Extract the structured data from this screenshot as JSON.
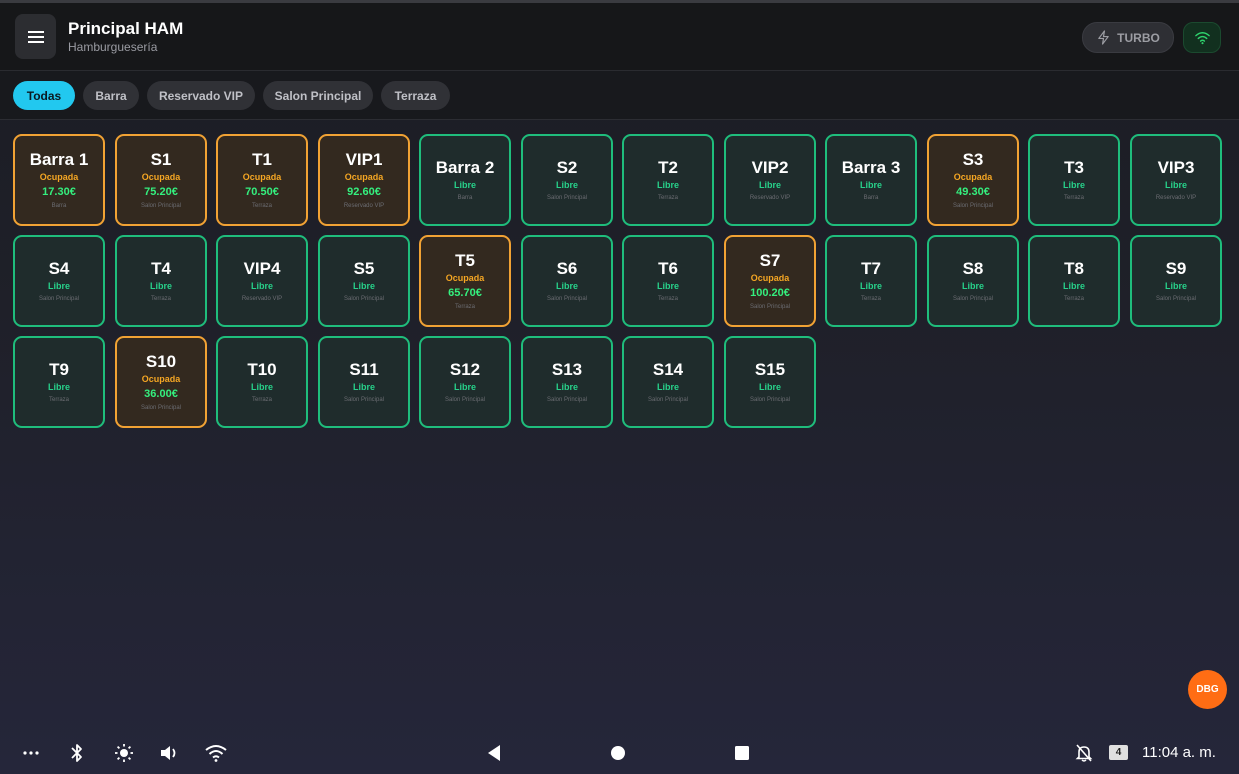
{
  "header": {
    "title": "Principal HAM",
    "subtitle": "Hamburguesería",
    "menu_icon": "hamburger-menu-icon",
    "turbo_label": "TURBO",
    "turbo_icon": "lightning-bolt-icon",
    "wifi_icon": "wifi-icon"
  },
  "tabs": [
    {
      "label": "Todas",
      "active": true
    },
    {
      "label": "Barra",
      "active": false
    },
    {
      "label": "Reservado VIP",
      "active": false
    },
    {
      "label": "Salon Principal",
      "active": false
    },
    {
      "label": "Terraza",
      "active": false
    }
  ],
  "tables": [
    {
      "name": "Barra 1",
      "status": "Ocupada",
      "amount": "17.30€",
      "zone": "Barra"
    },
    {
      "name": "S1",
      "status": "Ocupada",
      "amount": "75.20€",
      "zone": "Salon Principal"
    },
    {
      "name": "T1",
      "status": "Ocupada",
      "amount": "70.50€",
      "zone": "Terraza"
    },
    {
      "name": "VIP1",
      "status": "Ocupada",
      "amount": "92.60€",
      "zone": "Reservado VIP"
    },
    {
      "name": "Barra 2",
      "status": "Libre",
      "amount": "",
      "zone": "Barra"
    },
    {
      "name": "S2",
      "status": "Libre",
      "amount": "",
      "zone": "Salon Principal"
    },
    {
      "name": "T2",
      "status": "Libre",
      "amount": "",
      "zone": "Terraza"
    },
    {
      "name": "VIP2",
      "status": "Libre",
      "amount": "",
      "zone": "Reservado VIP"
    },
    {
      "name": "Barra 3",
      "status": "Libre",
      "amount": "",
      "zone": "Barra"
    },
    {
      "name": "S3",
      "status": "Ocupada",
      "amount": "49.30€",
      "zone": "Salon Principal"
    },
    {
      "name": "T3",
      "status": "Libre",
      "amount": "",
      "zone": "Terraza"
    },
    {
      "name": "VIP3",
      "status": "Libre",
      "amount": "",
      "zone": "Reservado VIP"
    },
    {
      "name": "S4",
      "status": "Libre",
      "amount": "",
      "zone": "Salon Principal"
    },
    {
      "name": "T4",
      "status": "Libre",
      "amount": "",
      "zone": "Terraza"
    },
    {
      "name": "VIP4",
      "status": "Libre",
      "amount": "",
      "zone": "Reservado VIP"
    },
    {
      "name": "S5",
      "status": "Libre",
      "amount": "",
      "zone": "Salon Principal"
    },
    {
      "name": "T5",
      "status": "Ocupada",
      "amount": "65.70€",
      "zone": "Terraza"
    },
    {
      "name": "S6",
      "status": "Libre",
      "amount": "",
      "zone": "Salon Principal"
    },
    {
      "name": "T6",
      "status": "Libre",
      "amount": "",
      "zone": "Terraza"
    },
    {
      "name": "S7",
      "status": "Ocupada",
      "amount": "100.20€",
      "zone": "Salon Principal"
    },
    {
      "name": "T7",
      "status": "Libre",
      "amount": "",
      "zone": "Terraza"
    },
    {
      "name": "S8",
      "status": "Libre",
      "amount": "",
      "zone": "Salon Principal"
    },
    {
      "name": "T8",
      "status": "Libre",
      "amount": "",
      "zone": "Terraza"
    },
    {
      "name": "S9",
      "status": "Libre",
      "amount": "",
      "zone": "Salon Principal"
    },
    {
      "name": "T9",
      "status": "Libre",
      "amount": "",
      "zone": "Terraza"
    },
    {
      "name": "S10",
      "status": "Ocupada",
      "amount": "36.00€",
      "zone": "Salon Principal"
    },
    {
      "name": "T10",
      "status": "Libre",
      "amount": "",
      "zone": "Terraza"
    },
    {
      "name": "S11",
      "status": "Libre",
      "amount": "",
      "zone": "Salon Principal"
    },
    {
      "name": "S12",
      "status": "Libre",
      "amount": "",
      "zone": "Salon Principal"
    },
    {
      "name": "S13",
      "status": "Libre",
      "amount": "",
      "zone": "Salon Principal"
    },
    {
      "name": "S14",
      "status": "Libre",
      "amount": "",
      "zone": "Salon Principal"
    },
    {
      "name": "S15",
      "status": "Libre",
      "amount": "",
      "zone": "Salon Principal"
    }
  ],
  "debug_button": {
    "label": "DBG"
  },
  "system_bar": {
    "left_icons": [
      "more-dots-icon",
      "bluetooth-icon",
      "brightness-icon",
      "volume-icon",
      "wifi-icon"
    ],
    "nav_icons": [
      "back-icon",
      "home-icon",
      "recents-icon"
    ],
    "right_icons": [
      "notifications-off-icon"
    ],
    "badge": "4",
    "time": "11:04 a. m."
  },
  "colors": {
    "accent": "#22c8ef",
    "libre_border": "#1fbd7c",
    "ocupada_border": "#f1a234",
    "amount_green": "#34ef7e",
    "debug_orange": "#ff6d14"
  }
}
